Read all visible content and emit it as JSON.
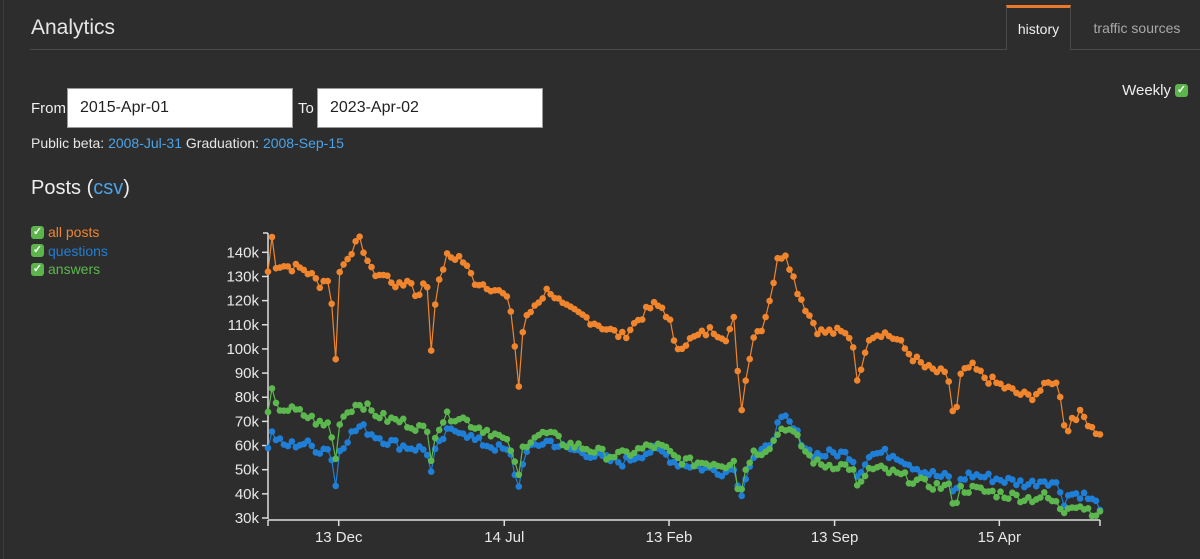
{
  "header": {
    "title": "Analytics",
    "tabs": [
      {
        "label": "history",
        "active": true
      },
      {
        "label": "traffic sources",
        "active": false
      }
    ]
  },
  "controls": {
    "weekly_label": "Weekly",
    "weekly_checked": true,
    "from_label": "From",
    "from_value": "2015-Apr-01",
    "to_label": "To",
    "to_value": "2023-Apr-02",
    "public_beta_label": "Public beta:",
    "public_beta_value": "2008-Jul-31",
    "graduation_label": "Graduation:",
    "graduation_value": "2008-Sep-15"
  },
  "section": {
    "title": "Posts",
    "csv_label": "csv",
    "open_paren": "(",
    "close_paren": ")"
  },
  "colors": {
    "all_posts": "#f0852d",
    "questions": "#1f7fd6",
    "answers": "#5cb84e",
    "link": "#4aa3e8",
    "accent": "#e8792a"
  },
  "chart_data": {
    "type": "line",
    "title": "Posts",
    "xlabel": "",
    "ylabel": "",
    "ylim": [
      30000,
      148000
    ],
    "yticks": [
      30000,
      40000,
      50000,
      60000,
      70000,
      80000,
      90000,
      100000,
      110000,
      120000,
      130000,
      140000
    ],
    "ytick_labels": [
      "30k",
      "40k",
      "50k",
      "60k",
      "70k",
      "80k",
      "90k",
      "100k",
      "110k",
      "120k",
      "130k",
      "140k"
    ],
    "x_points": 210,
    "xtick_positions": [
      0.085,
      0.284,
      0.482,
      0.681,
      0.879
    ],
    "xtick_labels": [
      "13 Dec",
      "14 Jul",
      "13 Feb",
      "13 Sep",
      "15 Apr"
    ],
    "grid": false,
    "legend": "top-left",
    "series": [
      {
        "name": "all posts",
        "color": "#f0852d",
        "control_points": [
          [
            0,
            132000
          ],
          [
            0.005,
            147000
          ],
          [
            0.01,
            135000
          ],
          [
            0.05,
            133000
          ],
          [
            0.07,
            127000
          ],
          [
            0.085,
            130000
          ],
          [
            0.088,
            98000
          ],
          [
            0.092,
            97000
          ],
          [
            0.096,
            131000
          ],
          [
            0.11,
            140000
          ],
          [
            0.125,
            145000
          ],
          [
            0.14,
            132000
          ],
          [
            0.16,
            130000
          ],
          [
            0.18,
            125000
          ],
          [
            0.19,
            130000
          ],
          [
            0.2,
            122000
          ],
          [
            0.215,
            128000
          ],
          [
            0.218,
            110000
          ],
          [
            0.222,
            95000
          ],
          [
            0.226,
            120000
          ],
          [
            0.24,
            138000
          ],
          [
            0.26,
            138000
          ],
          [
            0.28,
            128000
          ],
          [
            0.3,
            126000
          ],
          [
            0.32,
            122000
          ],
          [
            0.33,
            115000
          ],
          [
            0.336,
            93000
          ],
          [
            0.34,
            82000
          ],
          [
            0.345,
            110000
          ],
          [
            0.36,
            118000
          ],
          [
            0.38,
            125000
          ],
          [
            0.4,
            117000
          ],
          [
            0.43,
            113000
          ],
          [
            0.46,
            108000
          ],
          [
            0.48,
            105000
          ],
          [
            0.5,
            112000
          ],
          [
            0.52,
            118000
          ],
          [
            0.535,
            117000
          ],
          [
            0.545,
            110000
          ],
          [
            0.55,
            100000
          ],
          [
            0.56,
            102000
          ],
          [
            0.58,
            105000
          ],
          [
            0.6,
            108000
          ],
          [
            0.62,
            105000
          ],
          [
            0.63,
            112000
          ],
          [
            0.635,
            90000
          ],
          [
            0.64,
            75000
          ],
          [
            0.645,
            85000
          ],
          [
            0.655,
            105000
          ],
          [
            0.67,
            110000
          ],
          [
            0.685,
            130000
          ],
          [
            0.69,
            138000
          ],
          [
            0.7,
            140000
          ],
          [
            0.715,
            125000
          ],
          [
            0.73,
            115000
          ],
          [
            0.745,
            107000
          ],
          [
            0.77,
            107000
          ],
          [
            0.79,
            105000
          ],
          [
            0.795,
            90000
          ],
          [
            0.8,
            86000
          ],
          [
            0.81,
            105000
          ],
          [
            0.83,
            107000
          ],
          [
            0.85,
            104000
          ],
          [
            0.87,
            97000
          ],
          [
            0.89,
            92000
          ],
          [
            0.91,
            90000
          ],
          [
            0.92,
            88000
          ],
          [
            0.925,
            75000
          ],
          [
            0.93,
            71000
          ],
          [
            0.935,
            88000
          ],
          [
            0.95,
            93000
          ],
          [
            0.97,
            88000
          ],
          [
            0.99,
            85000
          ],
          [
            1.01,
            82000
          ],
          [
            1.03,
            80000
          ],
          [
            1.05,
            84000
          ],
          [
            1.06,
            87000
          ],
          [
            1.07,
            84000
          ],
          [
            1.075,
            73000
          ],
          [
            1.08,
            62000
          ],
          [
            1.085,
            72000
          ],
          [
            1.1,
            73000
          ],
          [
            1.12,
            66000
          ],
          [
            1.125,
            64000
          ]
        ]
      },
      {
        "name": "questions",
        "color": "#1f7fd6",
        "control_points": [
          [
            0,
            60000
          ],
          [
            0.005,
            65000
          ],
          [
            0.02,
            60000
          ],
          [
            0.05,
            61000
          ],
          [
            0.07,
            58000
          ],
          [
            0.085,
            60000
          ],
          [
            0.088,
            45000
          ],
          [
            0.092,
            43000
          ],
          [
            0.096,
            58000
          ],
          [
            0.11,
            64000
          ],
          [
            0.125,
            68000
          ],
          [
            0.14,
            65000
          ],
          [
            0.16,
            62000
          ],
          [
            0.18,
            60000
          ],
          [
            0.2,
            59000
          ],
          [
            0.215,
            58000
          ],
          [
            0.218,
            50000
          ],
          [
            0.222,
            48000
          ],
          [
            0.226,
            57000
          ],
          [
            0.24,
            65000
          ],
          [
            0.26,
            67000
          ],
          [
            0.28,
            62000
          ],
          [
            0.3,
            60000
          ],
          [
            0.32,
            58000
          ],
          [
            0.33,
            55000
          ],
          [
            0.336,
            45000
          ],
          [
            0.34,
            42000
          ],
          [
            0.345,
            55000
          ],
          [
            0.36,
            60000
          ],
          [
            0.38,
            62000
          ],
          [
            0.4,
            59000
          ],
          [
            0.43,
            57000
          ],
          [
            0.46,
            54000
          ],
          [
            0.48,
            53000
          ],
          [
            0.5,
            56000
          ],
          [
            0.52,
            58000
          ],
          [
            0.535,
            57000
          ],
          [
            0.55,
            53000
          ],
          [
            0.57,
            52000
          ],
          [
            0.6,
            50000
          ],
          [
            0.62,
            49000
          ],
          [
            0.63,
            52000
          ],
          [
            0.635,
            43000
          ],
          [
            0.64,
            40000
          ],
          [
            0.645,
            47000
          ],
          [
            0.655,
            55000
          ],
          [
            0.67,
            57000
          ],
          [
            0.685,
            65000
          ],
          [
            0.69,
            69000
          ],
          [
            0.7,
            71000
          ],
          [
            0.715,
            65000
          ],
          [
            0.73,
            58000
          ],
          [
            0.745,
            56000
          ],
          [
            0.77,
            57000
          ],
          [
            0.79,
            56000
          ],
          [
            0.795,
            49000
          ],
          [
            0.8,
            48000
          ],
          [
            0.81,
            56000
          ],
          [
            0.83,
            57000
          ],
          [
            0.85,
            56000
          ],
          [
            0.87,
            52000
          ],
          [
            0.89,
            49000
          ],
          [
            0.91,
            47000
          ],
          [
            0.92,
            47000
          ],
          [
            0.925,
            42000
          ],
          [
            0.93,
            40000
          ],
          [
            0.935,
            46000
          ],
          [
            0.95,
            48000
          ],
          [
            0.97,
            47000
          ],
          [
            0.99,
            46000
          ],
          [
            1.01,
            45000
          ],
          [
            1.03,
            44000
          ],
          [
            1.05,
            46000
          ],
          [
            1.06,
            45000
          ],
          [
            1.07,
            43000
          ],
          [
            1.075,
            36000
          ],
          [
            1.08,
            39000
          ],
          [
            1.085,
            40000
          ],
          [
            1.1,
            40000
          ],
          [
            1.12,
            36000
          ],
          [
            1.125,
            35000
          ]
        ]
      },
      {
        "name": "answers",
        "color": "#5cb84e",
        "control_points": [
          [
            0,
            72000
          ],
          [
            0.005,
            83000
          ],
          [
            0.01,
            76000
          ],
          [
            0.04,
            74000
          ],
          [
            0.06,
            71000
          ],
          [
            0.075,
            68000
          ],
          [
            0.085,
            70000
          ],
          [
            0.088,
            54000
          ],
          [
            0.092,
            54000
          ],
          [
            0.096,
            70000
          ],
          [
            0.11,
            75000
          ],
          [
            0.125,
            78000
          ],
          [
            0.14,
            74000
          ],
          [
            0.16,
            71000
          ],
          [
            0.18,
            70000
          ],
          [
            0.2,
            68000
          ],
          [
            0.215,
            66000
          ],
          [
            0.218,
            57000
          ],
          [
            0.222,
            55000
          ],
          [
            0.226,
            65000
          ],
          [
            0.24,
            72000
          ],
          [
            0.26,
            72000
          ],
          [
            0.28,
            68000
          ],
          [
            0.3,
            66000
          ],
          [
            0.32,
            62000
          ],
          [
            0.33,
            58000
          ],
          [
            0.336,
            48000
          ],
          [
            0.34,
            47000
          ],
          [
            0.345,
            60000
          ],
          [
            0.36,
            64000
          ],
          [
            0.38,
            65000
          ],
          [
            0.4,
            61000
          ],
          [
            0.43,
            59000
          ],
          [
            0.46,
            56000
          ],
          [
            0.48,
            56000
          ],
          [
            0.5,
            58000
          ],
          [
            0.52,
            60000
          ],
          [
            0.535,
            59000
          ],
          [
            0.55,
            55000
          ],
          [
            0.57,
            53000
          ],
          [
            0.6,
            53000
          ],
          [
            0.62,
            52000
          ],
          [
            0.63,
            55000
          ],
          [
            0.635,
            43000
          ],
          [
            0.64,
            41000
          ],
          [
            0.645,
            50000
          ],
          [
            0.655,
            57000
          ],
          [
            0.67,
            58000
          ],
          [
            0.685,
            62000
          ],
          [
            0.69,
            66000
          ],
          [
            0.7,
            68000
          ],
          [
            0.715,
            63000
          ],
          [
            0.73,
            56000
          ],
          [
            0.745,
            52000
          ],
          [
            0.77,
            52000
          ],
          [
            0.79,
            51000
          ],
          [
            0.795,
            43000
          ],
          [
            0.8,
            42000
          ],
          [
            0.81,
            50000
          ],
          [
            0.83,
            50000
          ],
          [
            0.85,
            48000
          ],
          [
            0.87,
            46000
          ],
          [
            0.89,
            44000
          ],
          [
            0.91,
            43000
          ],
          [
            0.92,
            43000
          ],
          [
            0.925,
            38000
          ],
          [
            0.93,
            36000
          ],
          [
            0.935,
            42000
          ],
          [
            0.95,
            42000
          ],
          [
            0.97,
            41000
          ],
          [
            0.99,
            40000
          ],
          [
            1.01,
            39000
          ],
          [
            1.03,
            38000
          ],
          [
            1.05,
            39000
          ],
          [
            1.06,
            37000
          ],
          [
            1.07,
            35000
          ],
          [
            1.075,
            32000
          ],
          [
            1.08,
            35000
          ],
          [
            1.085,
            36000
          ],
          [
            1.1,
            35000
          ],
          [
            1.12,
            32000
          ],
          [
            1.125,
            31000
          ]
        ]
      }
    ]
  }
}
